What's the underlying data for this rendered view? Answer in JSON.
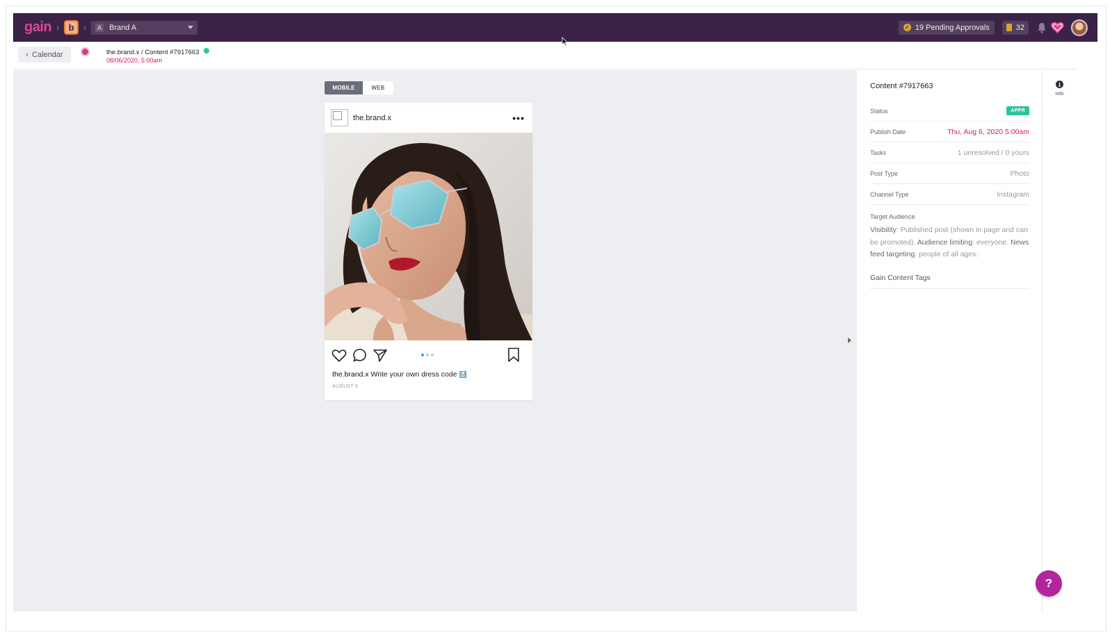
{
  "topbar": {
    "logo": "gain",
    "brand_initial": "b",
    "brand_select": {
      "icon_letter": "A",
      "value": "Brand A"
    },
    "pending_approvals": "19 Pending Approvals",
    "task_count": "32",
    "icons": [
      "check-circle-icon",
      "clipboard-icon",
      "bell-icon",
      "heart-icon",
      "user-avatar"
    ]
  },
  "subheader": {
    "back_label": "Calendar",
    "content_title": "the.brand.x / Content #7917663",
    "content_date": "08/06/2020, 5:00am",
    "status_color": "#2ac59c"
  },
  "preview": {
    "toggle": {
      "mobile": "MOBILE",
      "web": "WEB",
      "active": "MOBILE"
    },
    "post": {
      "username": "the.brand.x",
      "more": "•••",
      "caption_user": "the.brand.x",
      "caption_text": "Write your own dress code",
      "caption_emoji": "🔝",
      "date": "AUGUST 6",
      "carousel_dots": 3,
      "carousel_active": 1
    }
  },
  "panel": {
    "title": "Content #7917663",
    "rows": [
      {
        "label": "Status",
        "value": "APPR",
        "type": "badge"
      },
      {
        "label": "Publish Date",
        "value": "Thu, Aug 6, 2020 5:00am",
        "type": "red"
      },
      {
        "label": "Tasks",
        "value": "1 unresolved / 0 yours"
      },
      {
        "label": "Post Type",
        "value": "Photo"
      },
      {
        "label": "Channel Type",
        "value": "Instagram"
      }
    ],
    "target_audience": {
      "label": "Target Audience",
      "visibility_key": "Visibility",
      "visibility_val": ": Published post (shown in page and can be promoted). ",
      "limiting_key": "Audience limiting",
      "limiting_val": ": everyone. ",
      "newsfeed_key": "News feed targeting",
      "newsfeed_val": ": people of all ages."
    },
    "tags_label": "Gain Content Tags"
  },
  "info_tab": {
    "label": "Info"
  },
  "help": {
    "label": "?"
  },
  "colors": {
    "topbar": "#3b2347",
    "accent_pink": "#e0458f",
    "status_green": "#2ac59c",
    "date_red": "#d4204d",
    "help_purple": "#b3259b"
  }
}
